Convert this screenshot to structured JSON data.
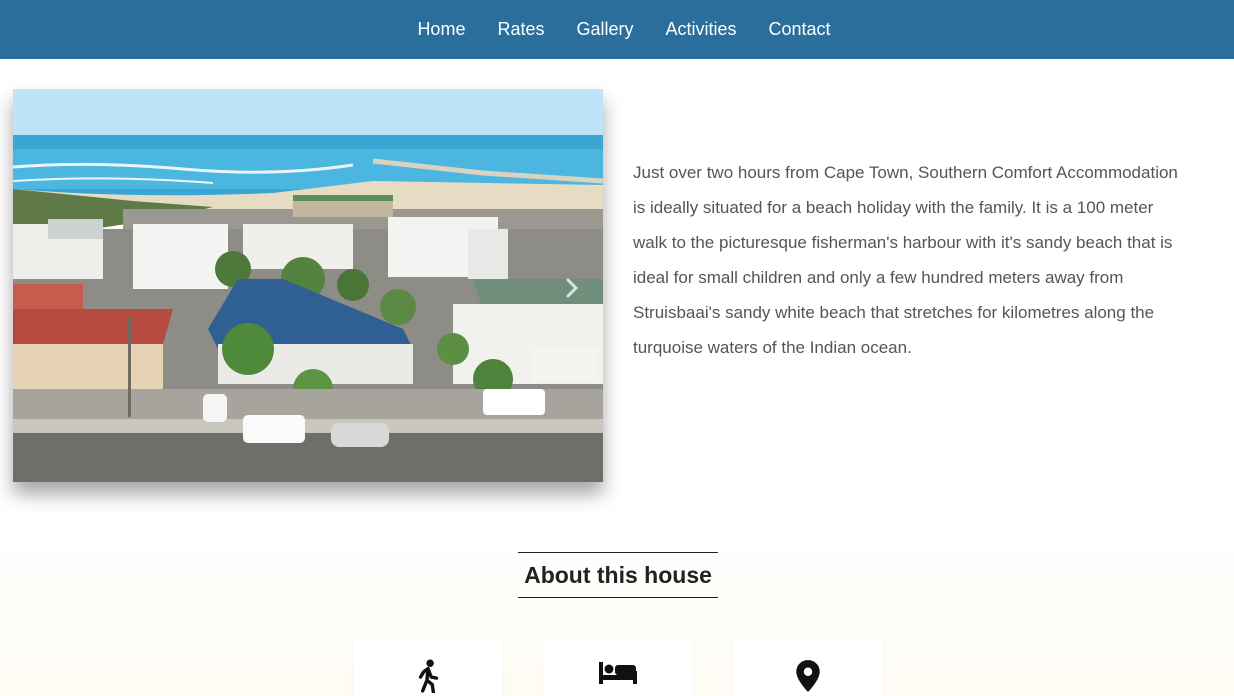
{
  "nav": {
    "items": [
      {
        "label": "Home"
      },
      {
        "label": "Rates"
      },
      {
        "label": "Gallery"
      },
      {
        "label": "Activities"
      },
      {
        "label": "Contact"
      }
    ]
  },
  "hero": {
    "image_icon": "aerial-photo-of-harbour-and-house",
    "next_icon": "chevron-right-icon"
  },
  "intro": {
    "text": "Just over two hours from Cape Town, Southern Comfort Accommodation is ideally situated for a beach holiday with the family. It is a 100 meter walk to the picturesque fisherman's harbour with it's sandy beach that is ideal for small children and only a few hundred meters away from Struisbaai's sandy white beach that stretches for kilometres along the turquoise waters of the Indian ocean."
  },
  "about": {
    "title": "About this house",
    "features": [
      {
        "icon": "walking-person-icon"
      },
      {
        "icon": "bed-icon"
      },
      {
        "icon": "map-pin-icon"
      }
    ]
  },
  "colors": {
    "nav_bg": "#2a6e9c",
    "nav_text": "#ffffff",
    "body_text": "#555555"
  }
}
